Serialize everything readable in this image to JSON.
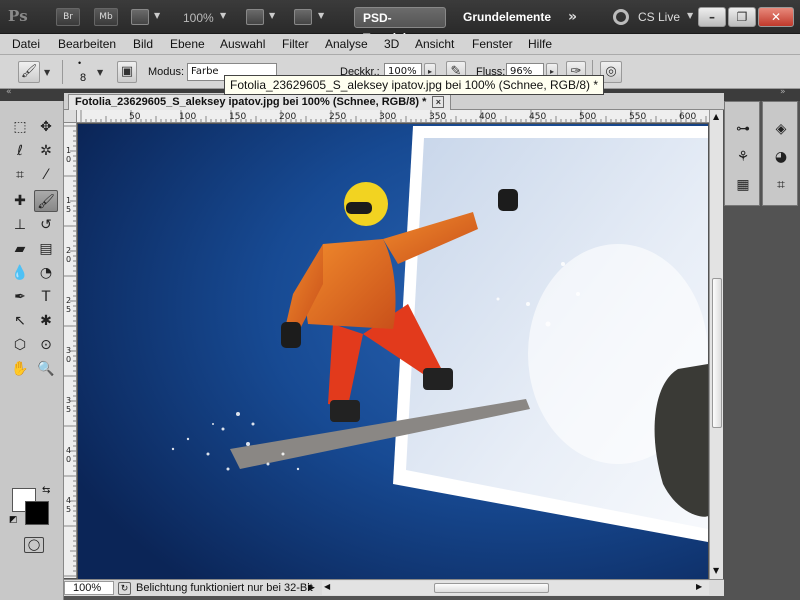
{
  "app": {
    "logo": "Ps",
    "bridge": "Br",
    "minibridge": "Mb",
    "zoom": "100%",
    "workspaces": [
      "PSD-Tutorials",
      "Grundelemente"
    ],
    "more": "»",
    "cslive": "CS Live"
  },
  "menu": [
    "Datei",
    "Bearbeiten",
    "Bild",
    "Ebene",
    "Auswahl",
    "Filter",
    "Analyse",
    "3D",
    "Ansicht",
    "Fenster",
    "Hilfe"
  ],
  "options": {
    "brush_size": "8",
    "mode_label": "Modus:",
    "mode_value": "Farbe",
    "opacity_label": "Deckkr.:",
    "opacity_value": "100%",
    "flow_label": "Fluss:",
    "flow_value": "96%"
  },
  "tooltip": "Fotolia_23629605_S_aleksey ipatov.jpg bei 100% (Schnee, RGB/8) *",
  "document": {
    "tab_title": "Fotolia_23629605_S_aleksey ipatov.jpg bei 100% (Schnee, RGB/8) *",
    "close": "×"
  },
  "ruler": {
    "top_ticks": [
      "50",
      "100",
      "150",
      "200",
      "250",
      "300",
      "350",
      "400",
      "450",
      "500",
      "550",
      "600"
    ],
    "left_ticks": [
      "1 0",
      "1 5",
      "2 0",
      "2 5",
      "3 0",
      "3 5",
      "4 0",
      "4 5"
    ]
  },
  "status": {
    "zoom": "100%",
    "message": "Belichtung funktioniert nur bei 32-Bit"
  },
  "colors": {
    "foreground": "#ffffff",
    "background": "#000000",
    "sky": "#0d2c63",
    "jacket": "#e86a1c",
    "pants": "#e23a1c"
  }
}
